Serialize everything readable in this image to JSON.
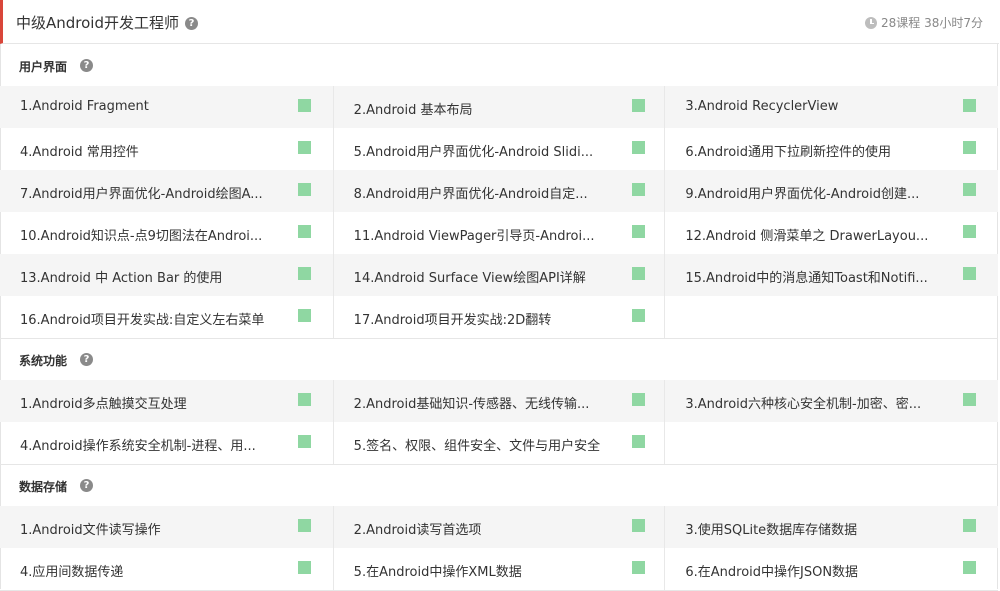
{
  "header": {
    "title": "中级Android开发工程师",
    "meta": "28课程 38小时7分"
  },
  "sections": [
    {
      "title": "用户界面",
      "rows": [
        [
          "1.Android Fragment",
          "2.Android 基本布局",
          "3.Android RecyclerView"
        ],
        [
          "4.Android 常用控件",
          "5.Android用户界面优化-Android Slidi...",
          "6.Android通用下拉刷新控件的使用"
        ],
        [
          "7.Android用户界面优化-Android绘图A...",
          "8.Android用户界面优化-Android自定...",
          "9.Android用户界面优化-Android创建..."
        ],
        [
          "10.Android知识点-点9切图法在Androi...",
          "11.Android ViewPager引导页-Androi...",
          "12.Android 侧滑菜单之 DrawerLayou..."
        ],
        [
          "13.Android 中 Action Bar 的使用",
          "14.Android Surface View绘图API详解",
          "15.Android中的消息通知Toast和Notifi..."
        ],
        [
          "16.Android项目开发实战:自定义左右菜单",
          "17.Android项目开发实战:2D翻转",
          ""
        ]
      ]
    },
    {
      "title": "系统功能",
      "rows": [
        [
          "1.Android多点触摸交互处理",
          "2.Android基础知识-传感器、无线传输...",
          "3.Android六种核心安全机制-加密、密..."
        ],
        [
          "4.Android操作系统安全机制-进程、用...",
          "5.签名、权限、组件安全、文件与用户安全",
          ""
        ]
      ]
    },
    {
      "title": "数据存储",
      "rows": [
        [
          "1.Android文件读写操作",
          "2.Android读写首选项",
          "3.使用SQLite数据库存储数据"
        ],
        [
          "4.应用间数据传递",
          "5.在Android中操作XML数据",
          "6.在Android中操作JSON数据"
        ]
      ]
    }
  ],
  "help_glyph": "?",
  "colors": {
    "accent": "#d9463a",
    "status": "#8fd7a2",
    "row_shade": "#f5f5f5"
  }
}
